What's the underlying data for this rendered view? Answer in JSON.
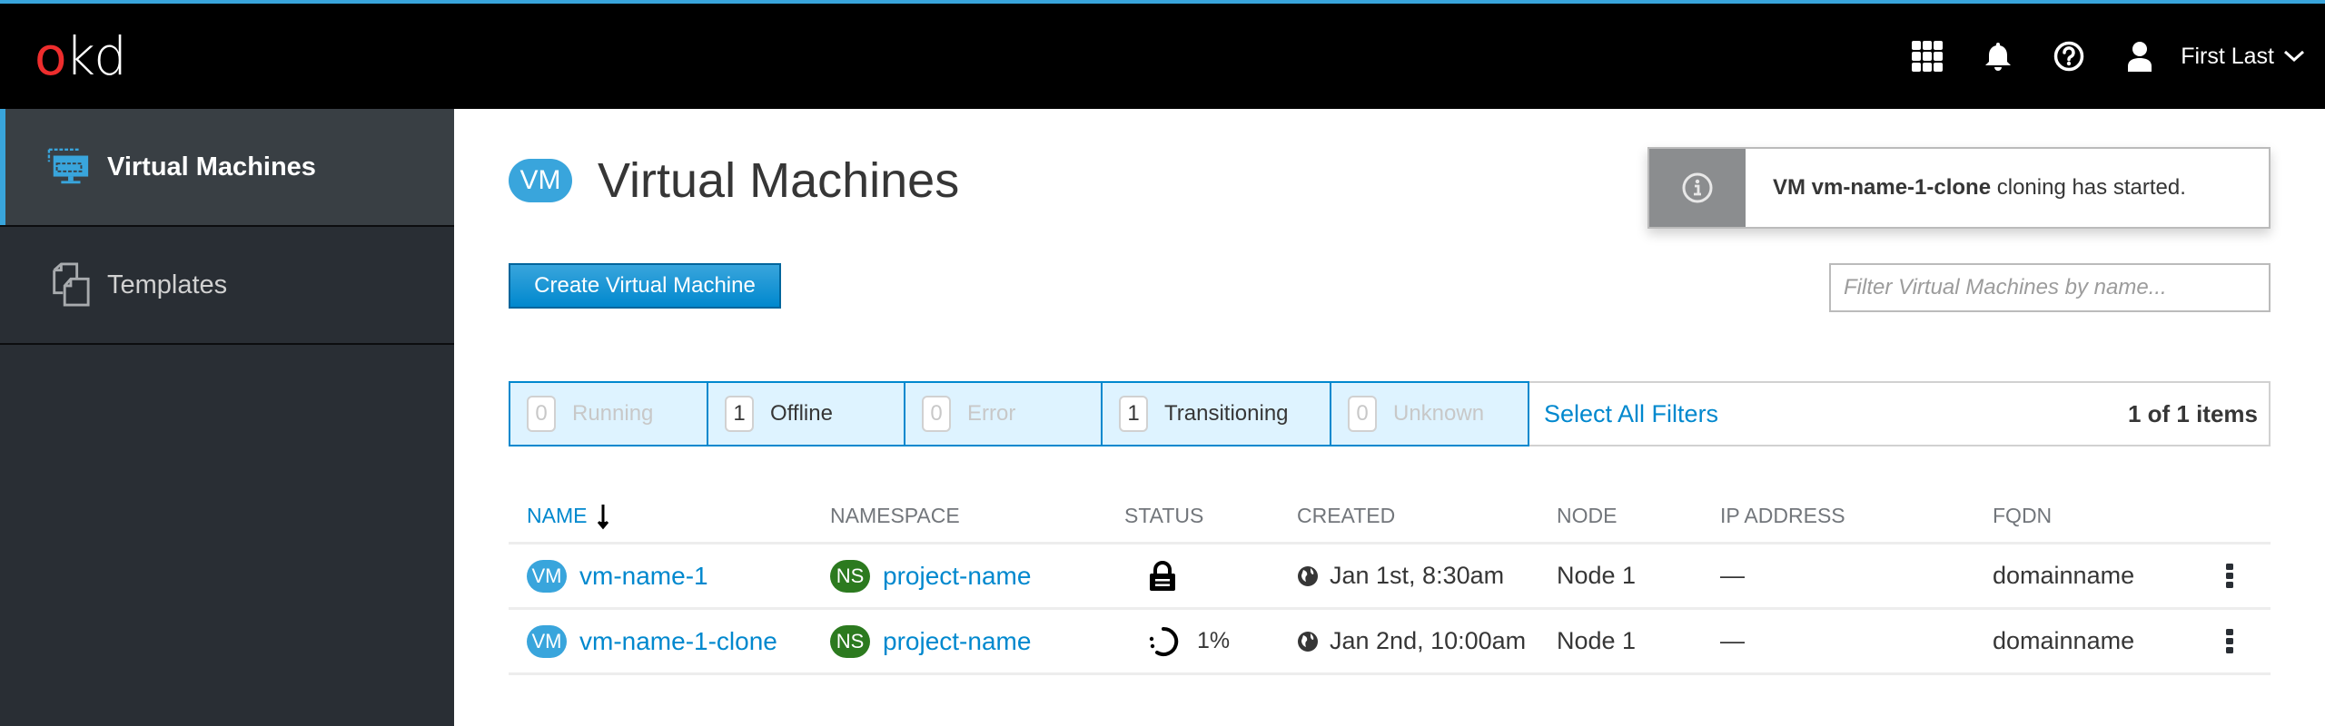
{
  "masthead": {
    "logo": {
      "o": "o",
      "kd": "kd"
    },
    "icons": [
      "app-launcher-icon",
      "notifications-bell-icon",
      "help-icon",
      "user-icon"
    ],
    "user_name": "First Last"
  },
  "sidebar": {
    "items": [
      {
        "label": "Virtual Machines",
        "icon": "virtual-machine-icon",
        "active": true
      },
      {
        "label": "Templates",
        "icon": "templates-icon",
        "active": false
      }
    ]
  },
  "page": {
    "badge": "VM",
    "title": "Virtual Machines",
    "create_button": "Create Virtual Machine"
  },
  "toast": {
    "icon": "info-icon",
    "bold_text": "VM vm-name-1-clone",
    "text": " cloning has started."
  },
  "filter_input": {
    "placeholder": "Filter Virtual Machines by name...",
    "value": ""
  },
  "status_filters": [
    {
      "count": "0",
      "label": "Running",
      "disabled": true
    },
    {
      "count": "1",
      "label": "Offline",
      "disabled": false
    },
    {
      "count": "0",
      "label": "Error",
      "disabled": true
    },
    {
      "count": "1",
      "label": "Transitioning",
      "disabled": false
    },
    {
      "count": "0",
      "label": "Unknown",
      "disabled": true
    }
  ],
  "select_all_filters": "Select All Filters",
  "item_count": "1 of 1 items",
  "table": {
    "columns": [
      "NAME",
      "NAMESPACE",
      "STATUS",
      "CREATED",
      "NODE",
      "IP ADDRESS",
      "FQDN"
    ],
    "sort": {
      "column": "NAME",
      "direction": "descending"
    },
    "rows": [
      {
        "vm_badge": "VM",
        "name": "vm-name-1",
        "ns_badge": "NS",
        "namespace": "project-name",
        "status_icon": "lock-icon",
        "status_text": "",
        "created": "Jan 1st, 8:30am",
        "node": "Node 1",
        "ip": "—",
        "fqdn": "domainname"
      },
      {
        "vm_badge": "VM",
        "name": "vm-name-1-clone",
        "ns_badge": "NS",
        "namespace": "project-name",
        "status_icon": "spinner-icon",
        "status_text": "1%",
        "created": "Jan 2nd, 10:00am",
        "node": "Node 1",
        "ip": "—",
        "fqdn": "domainname"
      }
    ]
  },
  "colors": {
    "accent": "#39a5dc",
    "link": "#0088ce",
    "namespace_badge": "#2c7a1f",
    "masthead": "#000000",
    "sidebar": "#292e34",
    "sidebar_active": "#393f44",
    "filter_active_bg": "#def3ff",
    "toast_icon_bg": "#8b8d8f"
  }
}
